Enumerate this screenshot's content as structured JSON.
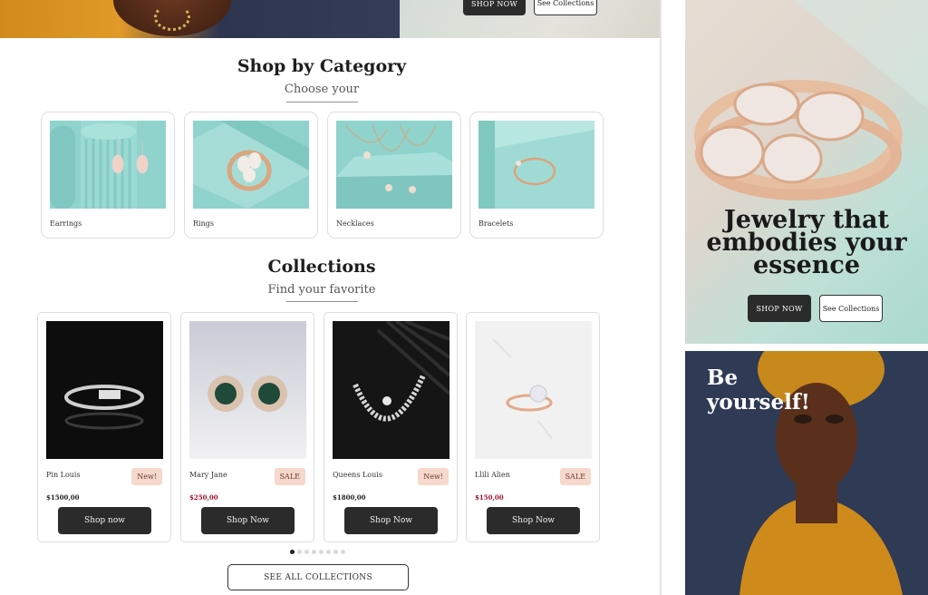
{
  "top_banner": {
    "shop_now_label": "SHOP NOW",
    "see_collections_label": "See Collections"
  },
  "category_section": {
    "title": "Shop by Category",
    "subtitle": "Choose your",
    "items": [
      {
        "label": "Earrings",
        "icon": "earrings-photo"
      },
      {
        "label": "Rings",
        "icon": "rings-photo"
      },
      {
        "label": "Necklaces",
        "icon": "necklaces-photo"
      },
      {
        "label": "Bracelets",
        "icon": "bracelets-photo"
      }
    ]
  },
  "collections_section": {
    "title": "Collections",
    "subtitle": "Find your favorite",
    "items": [
      {
        "name": "Pin Louis",
        "badge": "New!",
        "price": "$1500,00",
        "button": "Shop now"
      },
      {
        "name": "Mary Jane",
        "badge": "SALE",
        "price": "$250,00",
        "button": "Shop Now"
      },
      {
        "name": "Queens Louis",
        "badge": "New!",
        "price": "$1800,00",
        "button": "Shop Now"
      },
      {
        "name": "Llili Alien",
        "badge": "SALE",
        "price": "$150,00",
        "button": "Shop Now"
      }
    ],
    "see_all_label": "SEE ALL COLLECTIONS",
    "pagination": {
      "total": 8,
      "active": 1
    }
  },
  "hero": {
    "title_lines": [
      "Jewelry that",
      "embodies your",
      "essence"
    ],
    "shop_now_label": "SHOP NOW",
    "see_collections_label": "See Collections"
  },
  "promo": {
    "title_lines": [
      "Be",
      "yourself!"
    ]
  },
  "colors": {
    "dark_button": "#2b2b2b",
    "badge_bg": "#f6d8cc",
    "sale_price": "#a1122a",
    "category_bg": "#8fd3cc"
  }
}
